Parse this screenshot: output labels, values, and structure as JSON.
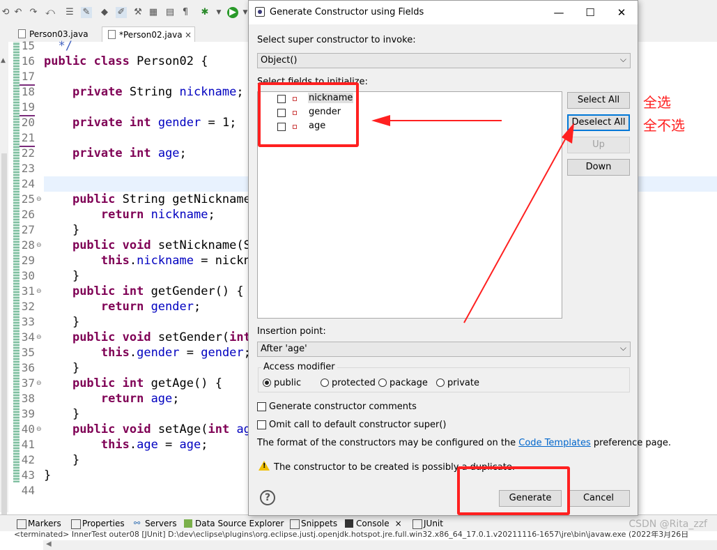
{
  "eclipse": {
    "tabs": [
      {
        "label": "Person03.java"
      },
      {
        "label": "*Person02.java",
        "close": "×"
      }
    ],
    "line_numbers": [
      "15",
      "16",
      "17",
      "18",
      "19",
      "20",
      "21",
      "22",
      "23",
      "24",
      "25",
      "26",
      "27",
      "28",
      "29",
      "30",
      "31",
      "32",
      "33",
      "34",
      "35",
      "36",
      "37",
      "38",
      "39",
      "40",
      "41",
      "42",
      "43",
      "44"
    ],
    "code_lines": [
      "  */",
      "public class Person02 {",
      "",
      "    private String nickname;",
      "",
      "    private int gender = 1;",
      "",
      "    private int age;",
      "",
      "",
      "    public String getNickname(",
      "        return nickname;",
      "    }",
      "    public void setNickname(St",
      "        this.nickname = nickna",
      "    }",
      "    public int getGender() {",
      "        return gender;",
      "    }",
      "    public void setGender(int",
      "        this.gender = gender;",
      "    }",
      "    public int getAge() {",
      "        return age;",
      "    }",
      "    public void setAge(int age",
      "        this.age = age;",
      "    }",
      "}",
      ""
    ],
    "views": [
      {
        "label": "Markers",
        "icon": "markers-icon"
      },
      {
        "label": "Properties",
        "icon": "properties-icon"
      },
      {
        "label": "Servers",
        "icon": "servers-icon"
      },
      {
        "label": "Data Source Explorer",
        "icon": "data-source-icon"
      },
      {
        "label": "Snippets",
        "icon": "snippets-icon"
      },
      {
        "label": "Console",
        "icon": "console-icon",
        "close": "×"
      },
      {
        "label": "JUnit",
        "icon": "junit-icon"
      }
    ],
    "status_text": "<terminated> InnerTest outer08 [JUnit] D:\\dev\\eclipse\\plugins\\org.eclipse.justj.openjdk.hotspot.jre.full.win32.x86_64_17.0.1.v20211116-1657\\jre\\bin\\javaw.exe  (2022年3月26日",
    "watermark": "CSDN @Rita_zzf"
  },
  "dialog": {
    "title": "Generate Constructor using Fields",
    "window_buttons": {
      "minimize": "—",
      "maximize": "☐",
      "close": "✕"
    },
    "super_label": "Select super constructor to invoke:",
    "super_value": "Object()",
    "fields_label": "Select fields to initialize:",
    "fields": [
      {
        "name": "nickname",
        "checked": false
      },
      {
        "name": "gender",
        "checked": false
      },
      {
        "name": "age",
        "checked": false
      }
    ],
    "buttons": {
      "select_all": "Select All",
      "deselect_all": "Deselect All",
      "up": "Up",
      "down": "Down",
      "generate": "Generate",
      "cancel": "Cancel"
    },
    "insertion_label": "Insertion point:",
    "insertion_value": "After 'age'",
    "access_modifier_label": "Access modifier",
    "access_modifiers": [
      {
        "label": "public",
        "selected": true
      },
      {
        "label": "protected",
        "selected": false
      },
      {
        "label": "package",
        "selected": false
      },
      {
        "label": "private",
        "selected": false
      }
    ],
    "gen_comments_label": "Generate constructor comments",
    "omit_super_label": "Omit call to default constructor super()",
    "templates_text_before": "The format of the constructors may be configured on the ",
    "templates_link": "Code Templates",
    "templates_text_after": " preference page.",
    "warning_text": "The constructor to be created is possibly a duplicate."
  },
  "annotations": {
    "select_all_note": "全选",
    "deselect_all_note": "全不选",
    "color": "#ff2020"
  }
}
